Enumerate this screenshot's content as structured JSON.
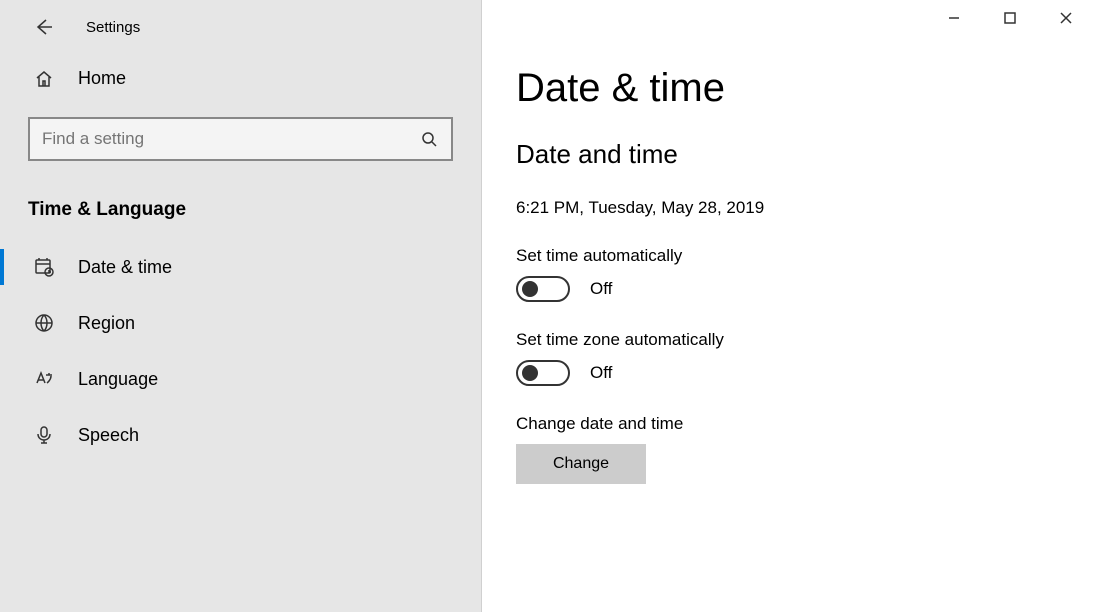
{
  "window": {
    "app_name": "Settings"
  },
  "sidebar": {
    "home_label": "Home",
    "search_placeholder": "Find a setting",
    "category_label": "Time & Language",
    "items": [
      {
        "label": "Date & time"
      },
      {
        "label": "Region"
      },
      {
        "label": "Language"
      },
      {
        "label": "Speech"
      }
    ]
  },
  "main": {
    "title": "Date & time",
    "section_heading": "Date and time",
    "current_datetime": "6:21 PM, Tuesday, May 28, 2019",
    "set_time_auto_label": "Set time automatically",
    "set_time_auto_state": "Off",
    "set_tz_auto_label": "Set time zone automatically",
    "set_tz_auto_state": "Off",
    "change_dt_label": "Change date and time",
    "change_button_label": "Change"
  }
}
